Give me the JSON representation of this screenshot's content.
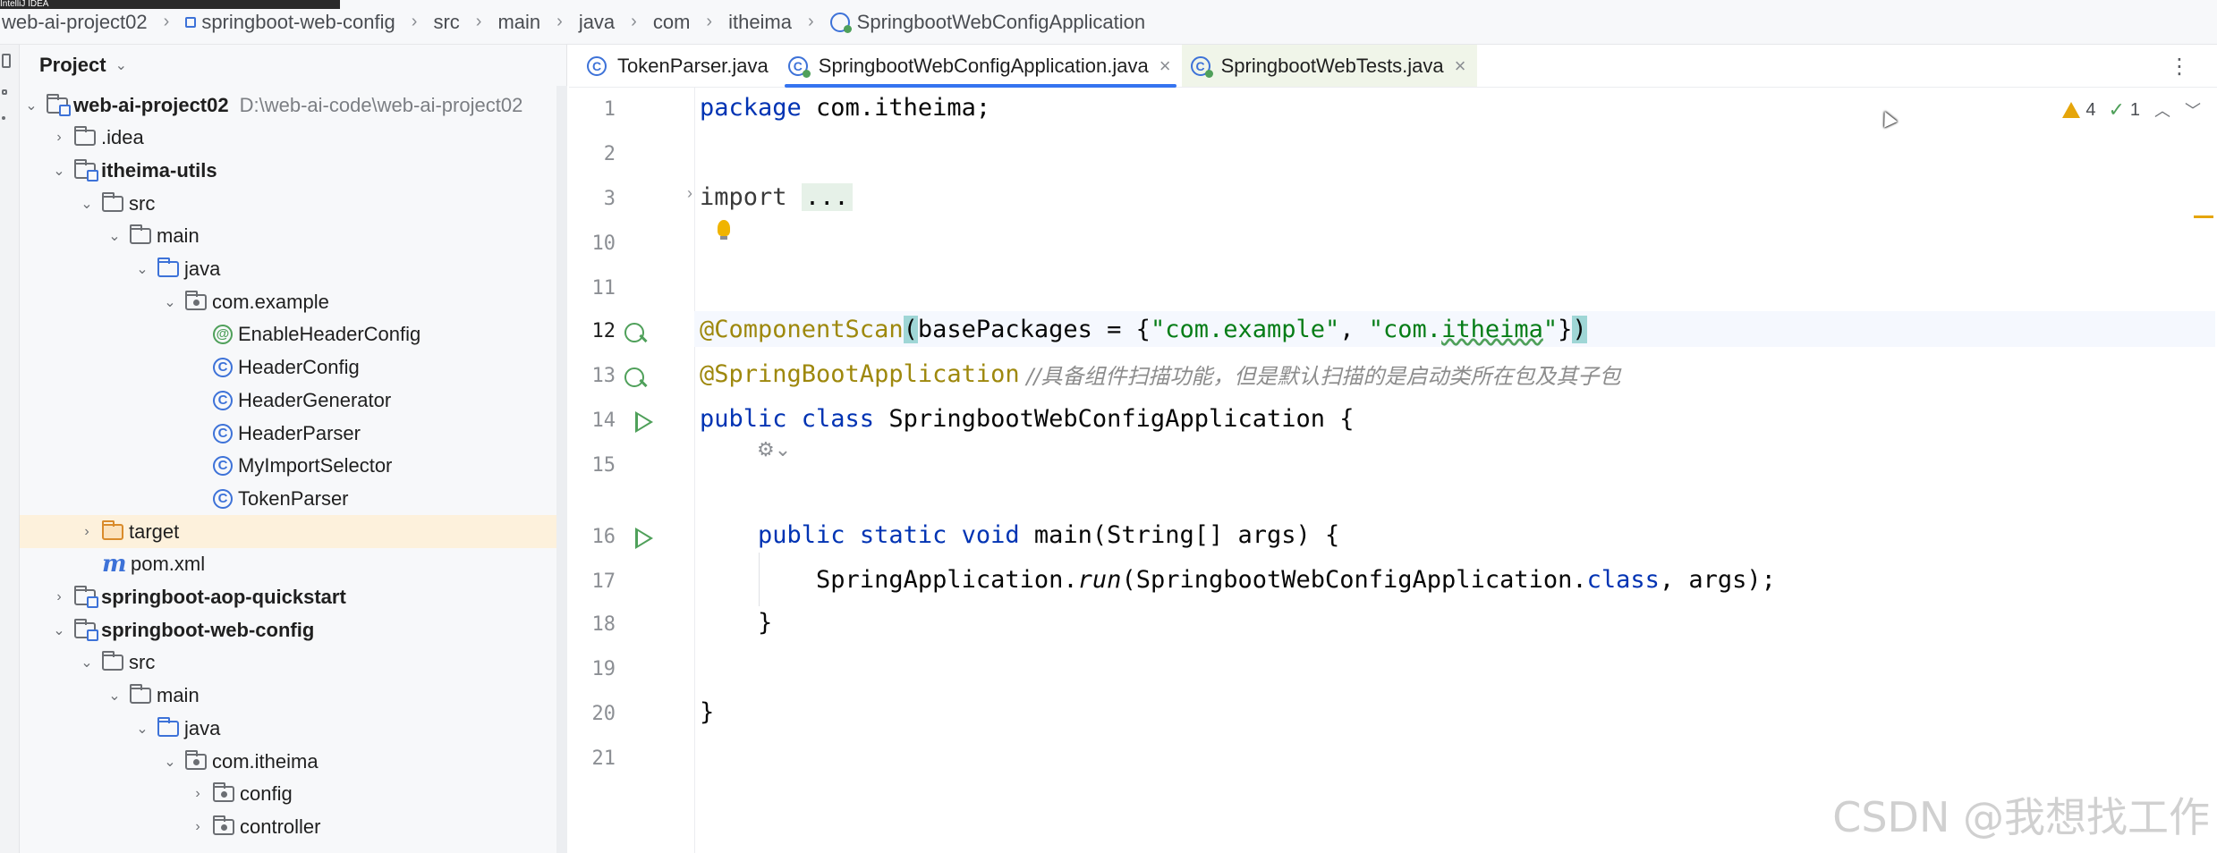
{
  "topstrip_text": "IntelliJ IDEA",
  "breadcrumbs": [
    {
      "label": "web-ai-project02",
      "icon": "none"
    },
    {
      "label": "springboot-web-config",
      "icon": "module-icon"
    },
    {
      "label": "src",
      "icon": "none"
    },
    {
      "label": "main",
      "icon": "none"
    },
    {
      "label": "java",
      "icon": "none"
    },
    {
      "label": "com",
      "icon": "none"
    },
    {
      "label": "itheima",
      "icon": "none"
    },
    {
      "label": "SpringbootWebConfigApplication",
      "icon": "spring-class-icon"
    }
  ],
  "project": {
    "title": "Project",
    "tree": [
      {
        "label": "web-ai-project02",
        "path": "D:\\web-ai-code\\web-ai-project02",
        "indent": 0,
        "arrow": "down",
        "icon": "module",
        "bold": true
      },
      {
        "label": ".idea",
        "indent": 1,
        "arrow": "right",
        "icon": "folder",
        "bold": false
      },
      {
        "label": "itheima-utils",
        "indent": 1,
        "arrow": "down",
        "icon": "module",
        "bold": true
      },
      {
        "label": "src",
        "indent": 2,
        "arrow": "down",
        "icon": "folder",
        "bold": false
      },
      {
        "label": "main",
        "indent": 3,
        "arrow": "down",
        "icon": "folder",
        "bold": false
      },
      {
        "label": "java",
        "indent": 4,
        "arrow": "down",
        "icon": "folder-blue",
        "bold": false
      },
      {
        "label": "com.example",
        "indent": 5,
        "arrow": "down",
        "icon": "package",
        "bold": false
      },
      {
        "label": "EnableHeaderConfig",
        "indent": 6,
        "arrow": "none",
        "icon": "annotation",
        "bold": false
      },
      {
        "label": "HeaderConfig",
        "indent": 6,
        "arrow": "none",
        "icon": "class",
        "bold": false
      },
      {
        "label": "HeaderGenerator",
        "indent": 6,
        "arrow": "none",
        "icon": "class",
        "bold": false
      },
      {
        "label": "HeaderParser",
        "indent": 6,
        "arrow": "none",
        "icon": "class",
        "bold": false
      },
      {
        "label": "MyImportSelector",
        "indent": 6,
        "arrow": "none",
        "icon": "class",
        "bold": false
      },
      {
        "label": "TokenParser",
        "indent": 6,
        "arrow": "none",
        "icon": "class",
        "bold": false
      },
      {
        "label": "target",
        "indent": 2,
        "arrow": "right",
        "icon": "folder-orange",
        "bold": false,
        "selected": true
      },
      {
        "label": "pom.xml",
        "indent": 2,
        "arrow": "none",
        "icon": "maven",
        "bold": false
      },
      {
        "label": "springboot-aop-quickstart",
        "indent": 1,
        "arrow": "right",
        "icon": "module",
        "bold": true
      },
      {
        "label": "springboot-web-config",
        "indent": 1,
        "arrow": "down",
        "icon": "module",
        "bold": true
      },
      {
        "label": "src",
        "indent": 2,
        "arrow": "down",
        "icon": "folder",
        "bold": false
      },
      {
        "label": "main",
        "indent": 3,
        "arrow": "down",
        "icon": "folder",
        "bold": false
      },
      {
        "label": "java",
        "indent": 4,
        "arrow": "down",
        "icon": "folder-blue",
        "bold": false
      },
      {
        "label": "com.itheima",
        "indent": 5,
        "arrow": "down",
        "icon": "package",
        "bold": false
      },
      {
        "label": "config",
        "indent": 6,
        "arrow": "right",
        "icon": "package",
        "bold": false
      },
      {
        "label": "controller",
        "indent": 6,
        "arrow": "right",
        "icon": "package",
        "bold": false
      }
    ]
  },
  "tabs": [
    {
      "label": "TokenParser.java",
      "icon": "class",
      "active": false,
      "closable": false
    },
    {
      "label": "SpringbootWebConfigApplication.java",
      "icon": "spring",
      "active": true,
      "closable": true
    },
    {
      "label": "SpringbootWebTests.java",
      "icon": "spring",
      "active": false,
      "closable": true,
      "hover": true
    }
  ],
  "inspections": {
    "warnings": "4",
    "checks": "1"
  },
  "line_numbers": [
    "1",
    "2",
    "3",
    "10",
    "11",
    "12",
    "13",
    "14",
    "15",
    "16",
    "17",
    "18",
    "19",
    "20",
    "21"
  ],
  "code": {
    "l1_kw": "package",
    "l1_rest": " com.itheima;",
    "l3_kw": "import",
    "l3_fold": "...",
    "l12_an": "@ComponentScan",
    "l12_p1": "(",
    "l12_attr": "basePackages = {",
    "l12_s1": "\"com.example\"",
    "l12_comma": ", ",
    "l12_s2a": "\"com.",
    "l12_s2b": "itheima",
    "l12_s2c": "\"",
    "l12_close": "}",
    "l12_paren": ")",
    "l13_an": "@SpringBootApplication",
    "l13_cmt": " //具备组件扫描功能，但是默认扫描的是启动类所在包及其子包",
    "l14_kw": "public class",
    "l14_rest": " SpringbootWebConfigApplication {",
    "l16_kw": "public static void",
    "l16_rest": " main(String[] args) {",
    "l17_a": "SpringApplication.",
    "l17_run": "run",
    "l17_b": "(SpringbootWebConfigApplication.",
    "l17_cls": "class",
    "l17_c": ", args);",
    "l18": "}",
    "l20": "}"
  },
  "watermark": "CSDN @我想找工作"
}
